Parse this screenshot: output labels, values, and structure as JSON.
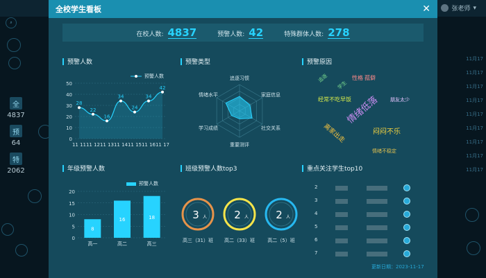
{
  "window": {
    "title": "全校学生看板",
    "user_name": "张老师"
  },
  "left_stats": [
    {
      "label": "全",
      "value": "4837"
    },
    {
      "label": "预",
      "value": "64"
    },
    {
      "label": "特",
      "value": "2062"
    }
  ],
  "right_times": [
    "11月17",
    "11月17",
    "11月17",
    "11月17",
    "11月17",
    "11月17",
    "11月17",
    "11月17",
    "11月17"
  ],
  "summary": [
    {
      "label": "在校人数:",
      "value": "4837"
    },
    {
      "label": "预警人数:",
      "value": "42"
    },
    {
      "label": "特殊群体人数:",
      "value": "278"
    }
  ],
  "panels": {
    "warning_count": "预警人数",
    "warning_types": "预警类型",
    "warning_reasons": "预警原因",
    "grade_warning": "年级预警人数",
    "class_top3": "班级预警人数top3",
    "focus_top10": "重点关注学生top10"
  },
  "colors": {
    "accent": "#27d3ff",
    "ring1": "#e6934a",
    "ring2": "#f5e44a",
    "ring3": "#27b8f0",
    "bar": "#27d3ff"
  },
  "chart_data": [
    {
      "type": "line",
      "title": "预警人数",
      "series": [
        {
          "name": "预警人数",
          "values": [
            28,
            22,
            16,
            34,
            24,
            34,
            42
          ]
        }
      ],
      "categories": [
        "11 11",
        "11 12",
        "11 13",
        "11 14",
        "11 15",
        "11 16",
        "11 17"
      ],
      "ylim": [
        0,
        50
      ],
      "yticks": [
        0,
        10,
        20,
        30,
        40,
        50
      ],
      "grid": true,
      "legend": "top-right"
    },
    {
      "type": "bar",
      "title": "年级预警人数",
      "series": [
        {
          "name": "预警人数",
          "values": [
            8,
            16,
            18
          ]
        }
      ],
      "categories": [
        "高一",
        "高二",
        "高三"
      ],
      "ylim": [
        0,
        20
      ],
      "yticks": [
        0,
        5,
        10,
        15,
        20
      ],
      "grid": true,
      "legend": "top-right"
    }
  ],
  "radar": {
    "axes": [
      "追逐习惯",
      "家庭信息",
      "社交关系",
      "重要测评",
      "学习成绩",
      "情绪水平"
    ]
  },
  "cloud": [
    {
      "text": "追逐",
      "color": "#7bdc8f"
    },
    {
      "text": "学生"
    },
    {
      "text": "性格",
      "color": "#ff8a8a"
    },
    {
      "text": "孤僻",
      "color": "#ff8a8a"
    },
    {
      "text": "经常不吃早饭",
      "color": "#d6ea4a"
    },
    {
      "text": "情绪低落",
      "color": "#c98cf0"
    },
    {
      "text": "朋友太少",
      "color": "#e6c4ff"
    },
    {
      "text": "离家出走",
      "color": "#f0c040"
    },
    {
      "text": "闷闷不乐",
      "color": "#f0d040"
    },
    {
      "text": "情绪不稳定",
      "color": "#e0c050"
    }
  ],
  "top3": [
    {
      "count": "3",
      "unit": "人",
      "label": "高三（31）班"
    },
    {
      "count": "2",
      "unit": "人",
      "label": "高二（33）班"
    },
    {
      "count": "2",
      "unit": "人",
      "label": "高二（5）班"
    }
  ],
  "top10_ranks": [
    "2",
    "3",
    "4",
    "5",
    "6",
    "7"
  ],
  "footer": {
    "update": "更新日期：2023-11-17"
  }
}
